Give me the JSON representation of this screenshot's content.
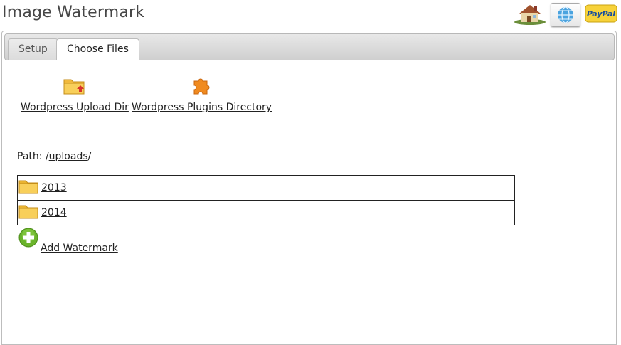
{
  "header": {
    "title": "Image Watermark",
    "icons": [
      "home-icon",
      "web-globe-icon",
      "paypal-icon"
    ],
    "paypal_label": "PayPal"
  },
  "tabs": [
    {
      "label": "Setup",
      "active": false
    },
    {
      "label": "Choose Files",
      "active": true
    }
  ],
  "shortcuts": {
    "upload_dir": "Wordpress Upload Dir",
    "plugins_dir": "Wordpress Plugins Directory"
  },
  "path": {
    "label": "Path:",
    "prefix": "/",
    "segment": "uploads",
    "suffix": "/"
  },
  "folders": [
    "2013",
    "2014"
  ],
  "add_watermark_label": "Add Watermark",
  "colors": {
    "folder": "#f5c84a",
    "accent_green": "#6ab42b",
    "puzzle_orange": "#f08a1f"
  }
}
